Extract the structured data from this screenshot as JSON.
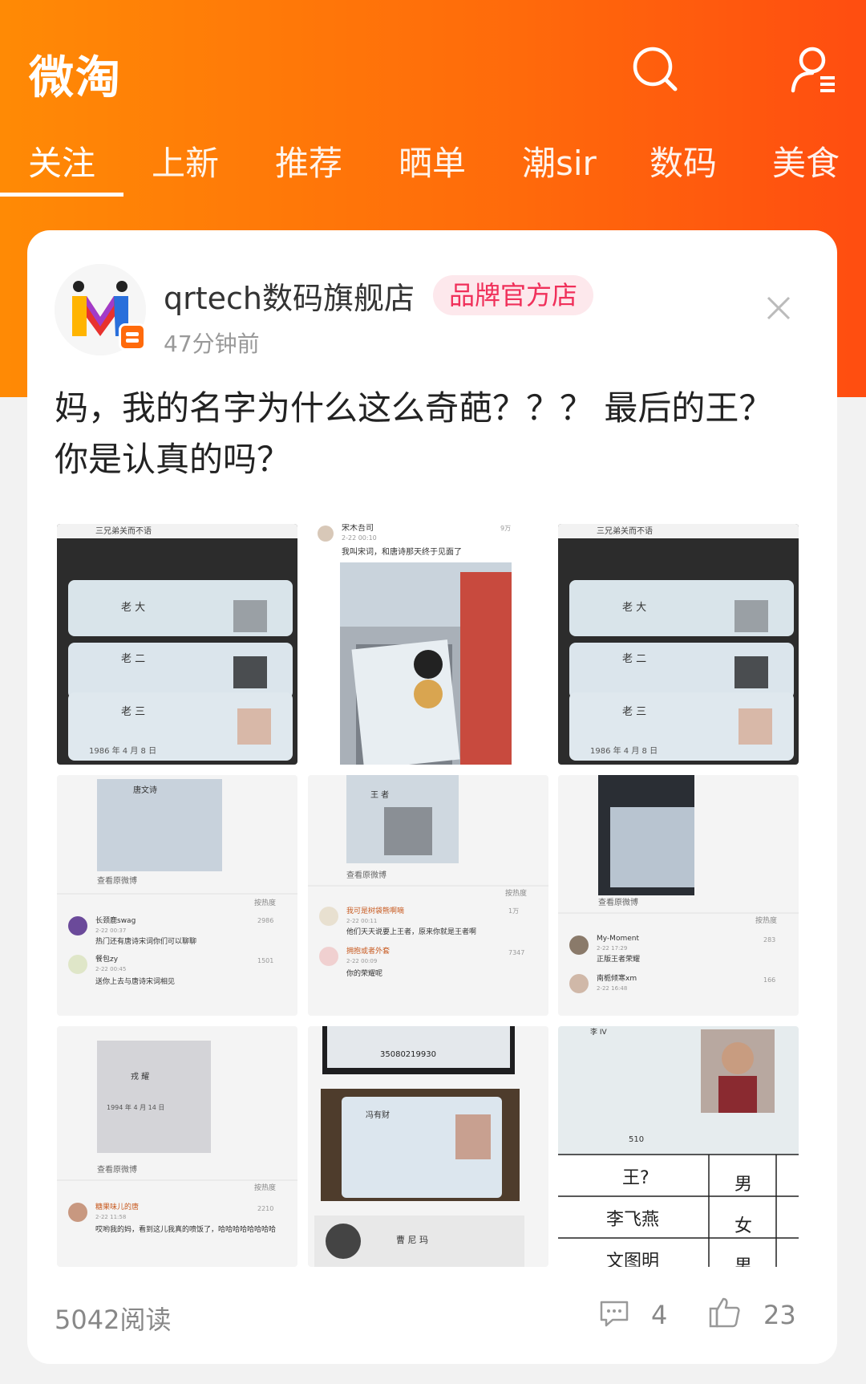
{
  "header": {
    "app_title": "微淘",
    "search_icon": "search-icon",
    "user_icon": "user-list-icon"
  },
  "tabs": [
    {
      "label": "关注",
      "active": true
    },
    {
      "label": "上新",
      "active": false
    },
    {
      "label": "推荐",
      "active": false
    },
    {
      "label": "晒单",
      "active": false
    },
    {
      "label": "潮sir",
      "active": false
    },
    {
      "label": "数码",
      "active": false
    },
    {
      "label": "美食",
      "active": false
    }
  ],
  "post": {
    "store_name": "qrtech数码旗舰店",
    "badge": "品牌官方店",
    "time": "47分钟前",
    "text": "妈，我的名字为什么这么奇葩？？？ 最后的王？你是认真的吗？",
    "reads": "5042阅读",
    "comments": "4",
    "likes": "23"
  },
  "images": [
    {
      "caption": "三兄弟关而不语",
      "names": [
        "老 大",
        "老 二",
        "老 三"
      ],
      "date": "1986 年 4 月 8 日"
    },
    {
      "user": "宋木吾司",
      "time": "2-22 00:10",
      "text": "我叫宋词，和唐诗那天终于见面了",
      "likes": "9万"
    },
    {
      "caption": "三兄弟关而不语",
      "names": [
        "老 大",
        "老 二",
        "老 三"
      ],
      "date": "1986 年 4 月 8 日"
    },
    {
      "card_name": "唐文诗",
      "link": "查看原微博",
      "sort": "按热度",
      "c1_user": "长颈鹿swag",
      "c1_time": "2-22 00:37",
      "c1_text": "热门还有唐诗宋词你们可以聊聊",
      "c1_likes": "2986",
      "c2_user": "餐包zy",
      "c2_time": "2-22 00:45",
      "c2_text": "送你上去与唐诗宋词相见",
      "c2_likes": "1501"
    },
    {
      "card_name": "王 者",
      "link": "查看原微博",
      "sort": "按热度",
      "c1_user": "我可是树袋熊啊嘀",
      "c1_time": "2-22 00:11",
      "c1_text": "他们天天说要上王者，原来你就是王者啊",
      "c1_likes": "1万",
      "c2_user": "拥抱或者外套",
      "c2_time": "2-22 00:09",
      "c2_text": "你的荣耀呢",
      "c2_likes": "7347"
    },
    {
      "link": "查看原微博",
      "sort": "按热度",
      "c1_user": "My-Moment",
      "c1_time": "2-22 17:29",
      "c1_text": "正版王者荣耀",
      "c1_likes": "283",
      "c2_user": "南栀倾寒xm",
      "c2_time": "2-22 16:48",
      "c2_likes": "166"
    },
    {
      "card_name": "戎 耀",
      "date": "1994 年 4 月 14 日",
      "link": "查看原微博",
      "sort": "按热度",
      "c1_user": "糖果味儿的唐",
      "c1_time": "2-22 11:58",
      "c1_text": "哎哟我的妈，看到这儿我真的喷饭了，哈哈哈哈哈哈哈哈",
      "c1_likes": "2210"
    },
    {
      "id_number": "35080219930",
      "card_name": "冯有财",
      "card_name2": "曹 尼 玛"
    },
    {
      "card_name": "李 IV",
      "id_prefix": "510",
      "table": [
        [
          "王?",
          "男"
        ],
        [
          "李飞燕",
          "女"
        ],
        [
          "文图明",
          "男"
        ]
      ]
    }
  ]
}
